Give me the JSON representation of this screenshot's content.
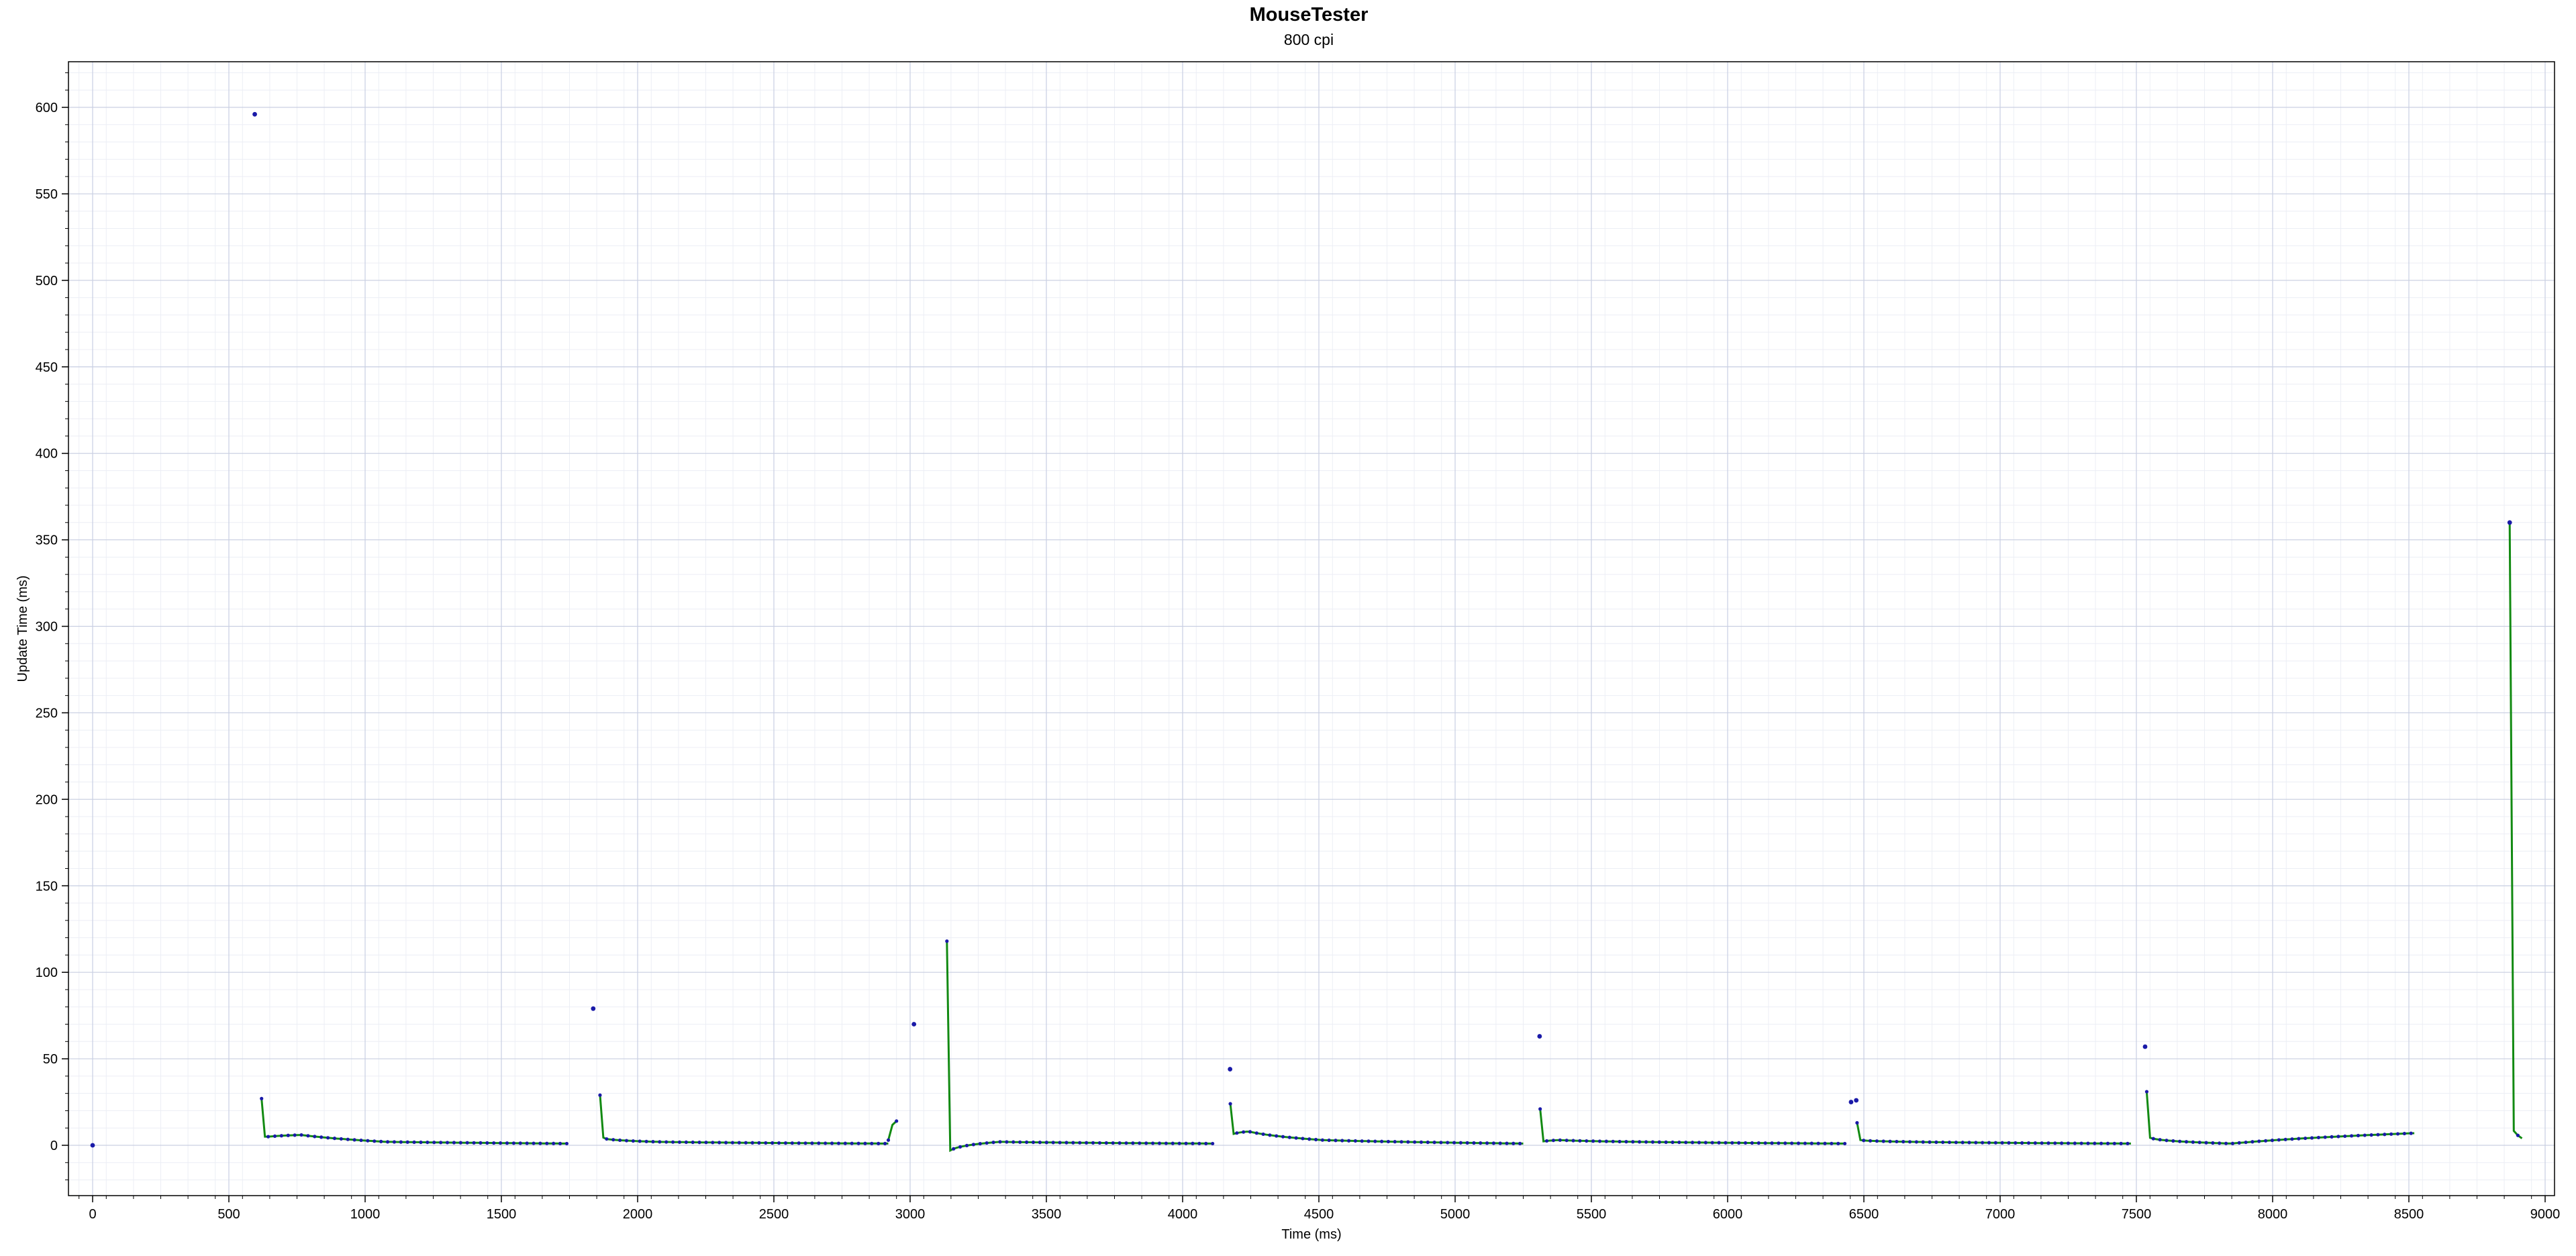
{
  "chart_data": {
    "type": "scatter",
    "title": "MouseTester",
    "subtitle": "800 cpi",
    "xlabel": "Time (ms)",
    "ylabel": "Update Time (ms)",
    "xlim": [
      -80,
      9000
    ],
    "ylim": [
      -30,
      625
    ],
    "xticks": [
      0,
      500,
      1000,
      1500,
      2000,
      2500,
      3000,
      3500,
      4000,
      4500,
      5000,
      5500,
      6000,
      6500,
      7000,
      7500,
      8000,
      8500,
      9000
    ],
    "yticks": [
      0,
      50,
      100,
      150,
      200,
      250,
      300,
      350,
      400,
      450,
      500,
      550,
      600
    ],
    "grid": true,
    "colors": {
      "points": "#1a1aa8",
      "line": "#128a12",
      "grid_major": "#c9cfe2",
      "grid_minor": "#eceef5",
      "axis": "#000000"
    },
    "series": [
      {
        "type": "scatter",
        "x": [
          0,
          595,
          1837,
          3014,
          4174,
          5310,
          6453,
          6472,
          7532,
          8870
        ],
        "y": [
          0,
          596,
          79,
          70,
          44,
          63,
          25,
          26,
          57,
          360
        ]
      },
      {
        "type": "line",
        "segments": [
          {
            "x_start": 620,
            "x_end": 1740,
            "y": [
              27,
              5,
              5,
              6,
              2,
              1
            ]
          },
          {
            "x_start": 1862,
            "x_end": 2920,
            "y": [
              29,
              4,
              2,
              1
            ]
          },
          {
            "x_start": 2920,
            "x_end": 2950,
            "y": [
              3,
              7,
              14
            ]
          },
          {
            "x_start": 3135,
            "x_end": 4110,
            "y": [
              118,
              -3,
              2,
              1
            ]
          },
          {
            "x_start": 4175,
            "x_end": 5250,
            "y": [
              24,
              6,
              8,
              3,
              1
            ]
          },
          {
            "x_start": 5312,
            "x_end": 6430,
            "y": [
              21,
              2,
              3,
              2,
              1
            ]
          },
          {
            "x_start": 6475,
            "x_end": 7480,
            "y": [
              13,
              3,
              2,
              1
            ]
          },
          {
            "x_start": 7538,
            "x_end": 8520,
            "y": [
              31,
              5,
              3,
              1,
              7
            ]
          },
          {
            "x_start": 8870,
            "x_end": 8915,
            "y": [
              360,
              -15,
              10,
              4
            ]
          }
        ]
      }
    ]
  }
}
